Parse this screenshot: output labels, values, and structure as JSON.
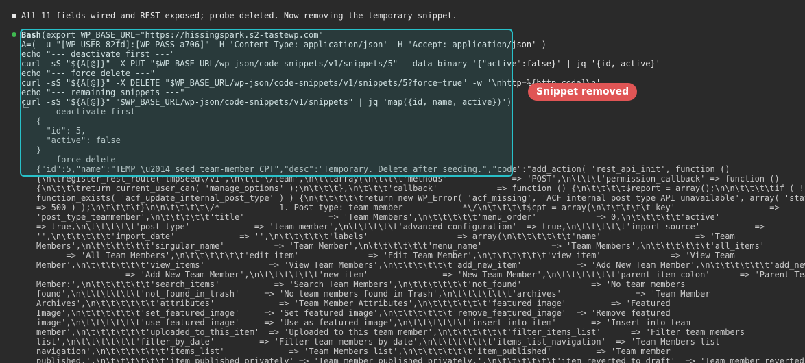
{
  "status_message": "All 11 fields wired and REST-exposed; probe deleted. Now removing the temporary snippet.",
  "command": {
    "tool": "Bash",
    "lines": [
      "(export WP_BASE_URL=\"https://hissingspark.s2-tastewp.com\"",
      "A=( -u \"[WP-USER-82fd]:[WP-PASS-a706]\" -H 'Content-Type: application/json' -H 'Accept: application/json' )",
      "echo \"--- deactivate first ---\"",
      "curl -sS \"${A[@]}\" -X PUT \"$WP_BASE_URL/wp-json/code-snippets/v1/snippets/5\" --data-binary '{\"active\":false}' | jq '{id, active}'",
      "echo \"--- force delete ---\"",
      "curl -sS \"${A[@]}\" -X DELETE \"$WP_BASE_URL/wp-json/code-snippets/v1/snippets/5?force=true\" -w '\\nhttp=%{http_code}\\n'",
      "echo \"--- remaining snippets ---\"",
      "curl -sS \"${A[@]}\" \"$WP_BASE_URL/wp-json/code-snippets/v1/snippets\" | jq 'map({id, name, active})')"
    ]
  },
  "output": [
    "--- deactivate first ---",
    "{",
    "  \"id\": 5,",
    "  \"active\": false",
    "}",
    "--- force delete ---",
    "{\"id\":5,\"name\":\"TEMP \\u2014 seed team-member CPT\",\"desc\":\"Temporary. Delete after seeding.\",\"code\":\"add_action( 'rest_api_init', function ()",
    "{\\n\\tregister_rest_route('tmpseed\\/v1',\\n\\t\\t'\\/team',\\n\\t\\tarray(\\n\\t\\t\\t'methods'             => 'POST',\\n\\t\\t\\t'permission_callback' => function ()",
    "{\\n\\t\\t\\treturn current_user_can( 'manage_options' );\\n\\t\\t\\t},\\n\\t\\t\\t'callback'            => function () {\\n\\t\\t\\t\\t$report = array();\\n\\n\\t\\t\\t\\tif ( !",
    "function_exists( 'acf_update_internal_post_type' ) ) {\\n\\t\\t\\t\\t\\treturn new WP_Error( 'acf_missing', 'ACF internal post type API unavailable', array( 'status'",
    "=> 500 ) );\\n\\t\\t\\t\\t}\\n\\n\\t\\t\\t\\t\\/* ---------- 1. Post type: team-member ---------- *\\/\\n\\t\\t\\t\\t$cpt = array(\\n\\t\\t\\t\\t\\t'key'                   =>",
    "'post_type_teammember',\\n\\t\\t\\t\\t\\t'title'                 => 'Team Members',\\n\\t\\t\\t\\t\\t'menu_order'            => 0,\\n\\t\\t\\t\\t\\t'active'",
    "=> true,\\n\\t\\t\\t\\t\\t'post_type'             => 'team-member',\\n\\t\\t\\t\\t\\t'advanced_configuration'  => true,\\n\\t\\t\\t\\t\\t'import_source'           =>",
    "'',\\n\\t\\t\\t\\t\\t'import_date'             => '',\\n\\t\\t\\t\\t\\t'labels'                  => array(\\n\\t\\t\\t\\t\\t\\t'name'                   => 'Team",
    "Members',\\n\\t\\t\\t\\t\\t\\t'singular_name'          => 'Team Member',\\n\\t\\t\\t\\t\\t\\t'menu_name'              => 'Team Members',\\n\\t\\t\\t\\t\\t\\t'all_items'",
    "      => 'All Team Members',\\n\\t\\t\\t\\t\\t\\t'edit_item'              => 'Edit Team Member',\\n\\t\\t\\t\\t\\t\\t'view_item'              => 'View Team",
    "Member',\\n\\t\\t\\t\\t\\t\\t'view_items'             => 'View Team Members',\\n\\t\\t\\t\\t\\t\\t'add_new_item'           => 'Add New Team Member',\\n\\t\\t\\t\\t\\t\\t'add_new",
    "                  => 'Add New Team Member',\\n\\t\\t\\t\\t\\t\\t'new_item'               => 'New Team Member',\\n\\t\\t\\t\\t\\t\\t'parent_item_colon'      => 'Parent Team",
    "Member:',\\n\\t\\t\\t\\t\\t\\t'search_items'           => 'Search Team Members',\\n\\t\\t\\t\\t\\t\\t'not_found'              => 'No team members",
    "found',\\n\\t\\t\\t\\t\\t\\t'not_found_in_trash'     => 'No team members found in Trash',\\n\\t\\t\\t\\t\\t\\t'archives'               => 'Team Member",
    "Archives',\\n\\t\\t\\t\\t\\t\\t'attributes'             => 'Team Member Attributes',\\n\\t\\t\\t\\t\\t\\t'featured_image'         => 'Featured",
    "Image',\\n\\t\\t\\t\\t\\t\\t'set_featured_image'     => 'Set featured image',\\n\\t\\t\\t\\t\\t\\t'remove_featured_image'  => 'Remove featured",
    "image',\\n\\t\\t\\t\\t\\t\\t'use_featured_image'     => 'Use as featured image',\\n\\t\\t\\t\\t\\t\\t'insert_into_item'       => 'Insert into team",
    "member',\\n\\t\\t\\t\\t\\t\\t'uploaded_to_this_item'  => 'Uploaded to this team member',\\n\\t\\t\\t\\t\\t\\t'filter_items_list'      => 'Filter team members",
    "list',\\n\\t\\t\\t\\t\\t\\t'filter_by_date'         => 'Filter team members by date',\\n\\t\\t\\t\\t\\t\\t'items_list_navigation'  => 'Team Members list",
    "navigation',\\n\\t\\t\\t\\t\\t\\t'items_list'             => 'Team Members list',\\n\\t\\t\\t\\t\\t\\t'item_published'         => 'Team member",
    "published.',\\n\\t\\t\\t\\t\\t\\t'item_published_privately' => 'Team member published privately.',\\n\\t\\t\\t\\t\\t\\t'item_reverted_to_draft'  => 'Team member reverted to"
  ],
  "annotation": {
    "label": "Snippet removed",
    "color": "#e05555",
    "box_color": "#28c0c8"
  }
}
